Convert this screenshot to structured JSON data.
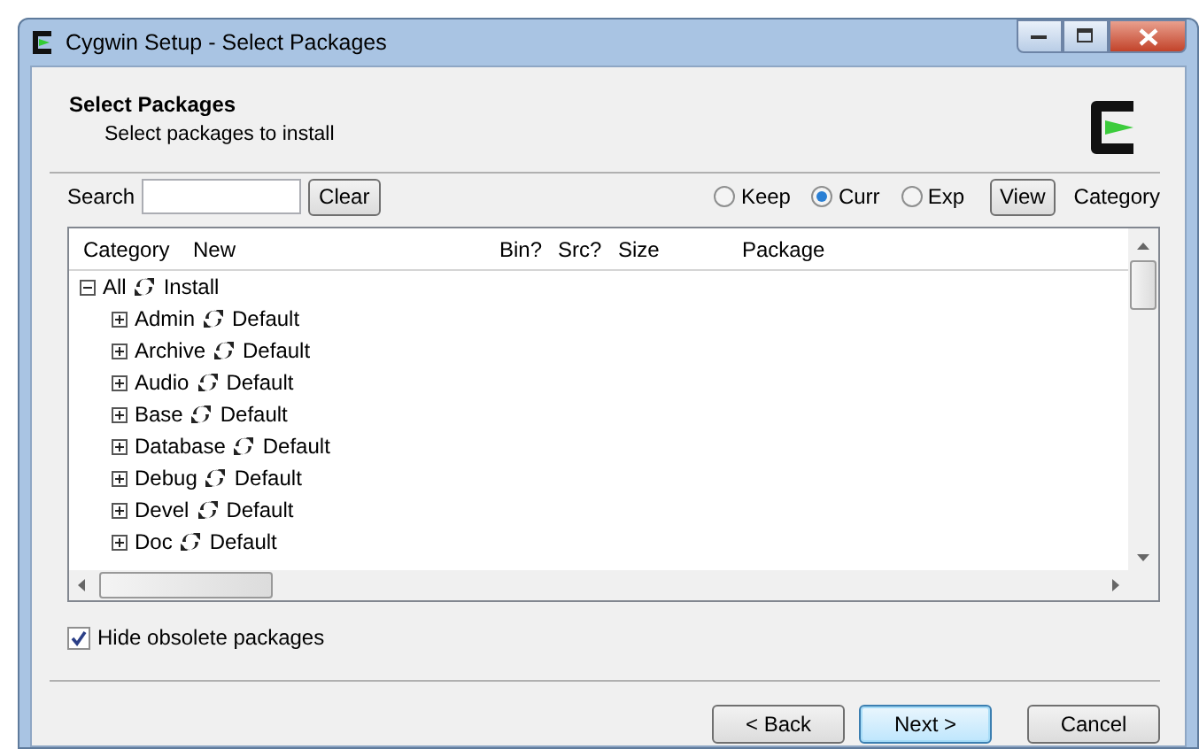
{
  "window": {
    "title": "Cygwin Setup - Select Packages"
  },
  "header": {
    "title": "Select Packages",
    "subtitle": "Select packages to install"
  },
  "search": {
    "label": "Search",
    "clear_button": "Clear"
  },
  "view_options": [
    {
      "label": "Keep",
      "selected": false
    },
    {
      "label": "Curr",
      "selected": true
    },
    {
      "label": "Exp",
      "selected": false
    }
  ],
  "view_button": "View",
  "view_mode": "Category",
  "table": {
    "columns": [
      "Category",
      "New",
      "Bin?",
      "Src?",
      "Size",
      "Package"
    ],
    "tree": [
      {
        "label": "All",
        "action": "Install",
        "expanded": true,
        "children": [
          {
            "label": "Admin",
            "action": "Default",
            "expanded": false
          },
          {
            "label": "Archive",
            "action": "Default",
            "expanded": false
          },
          {
            "label": "Audio",
            "action": "Default",
            "expanded": false
          },
          {
            "label": "Base",
            "action": "Default",
            "expanded": false
          },
          {
            "label": "Database",
            "action": "Default",
            "expanded": false
          },
          {
            "label": "Debug",
            "action": "Default",
            "expanded": false
          },
          {
            "label": "Devel",
            "action": "Default",
            "expanded": false
          },
          {
            "label": "Doc",
            "action": "Default",
            "expanded": false
          }
        ]
      }
    ]
  },
  "hide_obsolete": {
    "label": "Hide obsolete packages",
    "checked": true
  },
  "buttons": [
    {
      "label": "< Back",
      "focused": false
    },
    {
      "label": "Next >",
      "focused": true
    },
    {
      "label": "Cancel",
      "focused": false
    }
  ]
}
